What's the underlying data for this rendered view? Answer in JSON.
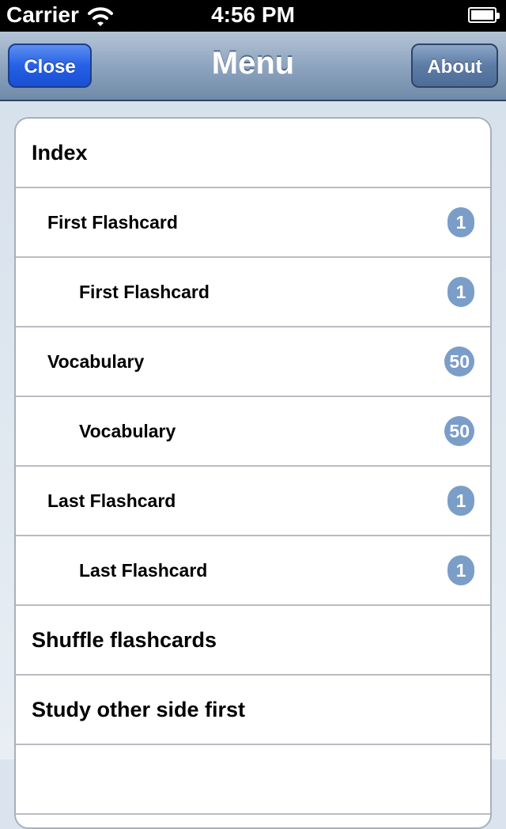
{
  "status_bar": {
    "carrier": "Carrier",
    "time": "4:56 PM"
  },
  "nav": {
    "title": "Menu",
    "left_button": "Close",
    "right_button": "About"
  },
  "menu": {
    "items": [
      {
        "label": "Index",
        "level": 0,
        "count": null
      },
      {
        "label": "First Flashcard",
        "level": 1,
        "count": "1"
      },
      {
        "label": "First Flashcard",
        "level": 2,
        "count": "1"
      },
      {
        "label": "Vocabulary",
        "level": 1,
        "count": "50"
      },
      {
        "label": "Vocabulary",
        "level": 2,
        "count": "50"
      },
      {
        "label": "Last Flashcard",
        "level": 1,
        "count": "1"
      },
      {
        "label": "Last Flashcard",
        "level": 2,
        "count": "1"
      },
      {
        "label": "Shuffle flashcards",
        "level": 0,
        "count": null
      },
      {
        "label": "Study other side first",
        "level": 0,
        "count": null
      },
      {
        "label": "",
        "level": 0,
        "count": null
      }
    ]
  },
  "colors": {
    "badge": "#7b9ec8",
    "close_button": "#2560e6",
    "nav_bar": "#8ea5bf"
  },
  "icons": {
    "wifi": "wifi-icon",
    "battery": "battery-icon"
  }
}
